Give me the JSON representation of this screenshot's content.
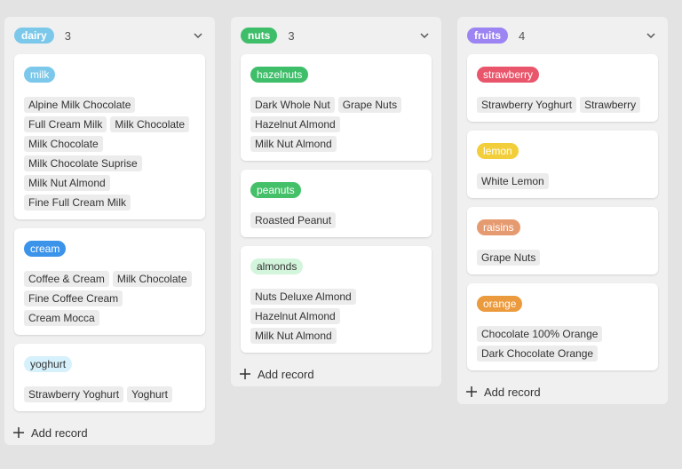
{
  "board": {
    "add_record_label": "Add record",
    "columns": [
      {
        "label": "dairy",
        "count": "3",
        "color": "#7cc8ea",
        "cards": [
          {
            "tag": "milk",
            "tag_bg": "#7cc8ea",
            "tag_fg": "#ffffff",
            "items": [
              "Alpine Milk Chocolate",
              "Full Cream Milk",
              "Milk Chocolate",
              "Milk Chocolate",
              "Milk Chocolate Suprise",
              "Milk Nut Almond",
              "Fine Full Cream Milk"
            ]
          },
          {
            "tag": "cream",
            "tag_bg": "#3c93ea",
            "tag_fg": "#ffffff",
            "items": [
              "Coffee & Cream",
              "Milk Chocolate",
              "Fine Coffee Cream",
              "Cream Mocca"
            ]
          },
          {
            "tag": "yoghurt",
            "tag_bg": "#d6f1fb",
            "tag_fg": "#333333",
            "items": [
              "Strawberry Yoghurt",
              "Yoghurt"
            ]
          }
        ]
      },
      {
        "label": "nuts",
        "count": "3",
        "color": "#3fbe6a",
        "cards": [
          {
            "tag": "hazelnuts",
            "tag_bg": "#3fbe6a",
            "tag_fg": "#ffffff",
            "items": [
              "Dark Whole Nut",
              "Grape Nuts",
              "Hazelnut Almond",
              "Milk Nut Almond"
            ]
          },
          {
            "tag": "peanuts",
            "tag_bg": "#44c068",
            "tag_fg": "#ffffff",
            "items": [
              "Roasted Peanut"
            ]
          },
          {
            "tag": "almonds",
            "tag_bg": "#d3f5dc",
            "tag_fg": "#333333",
            "items": [
              "Nuts Deluxe Almond",
              "Hazelnut Almond",
              "Milk Nut Almond"
            ]
          }
        ]
      },
      {
        "label": "fruits",
        "count": "4",
        "color": "#9c84f2",
        "cards": [
          {
            "tag": "strawberry",
            "tag_bg": "#e9566b",
            "tag_fg": "#ffffff",
            "items": [
              "Strawberry Yoghurt",
              "Strawberry"
            ]
          },
          {
            "tag": "lemon",
            "tag_bg": "#f2cf3a",
            "tag_fg": "#ffffff",
            "items": [
              "White Lemon"
            ]
          },
          {
            "tag": "raisins",
            "tag_bg": "#e69a70",
            "tag_fg": "#ffffff",
            "items": [
              "Grape Nuts"
            ]
          },
          {
            "tag": "orange",
            "tag_bg": "#eb9a3d",
            "tag_fg": "#ffffff",
            "items": [
              "Chocolate 100% Orange",
              "Dark Chocolate Orange"
            ]
          }
        ]
      }
    ]
  }
}
